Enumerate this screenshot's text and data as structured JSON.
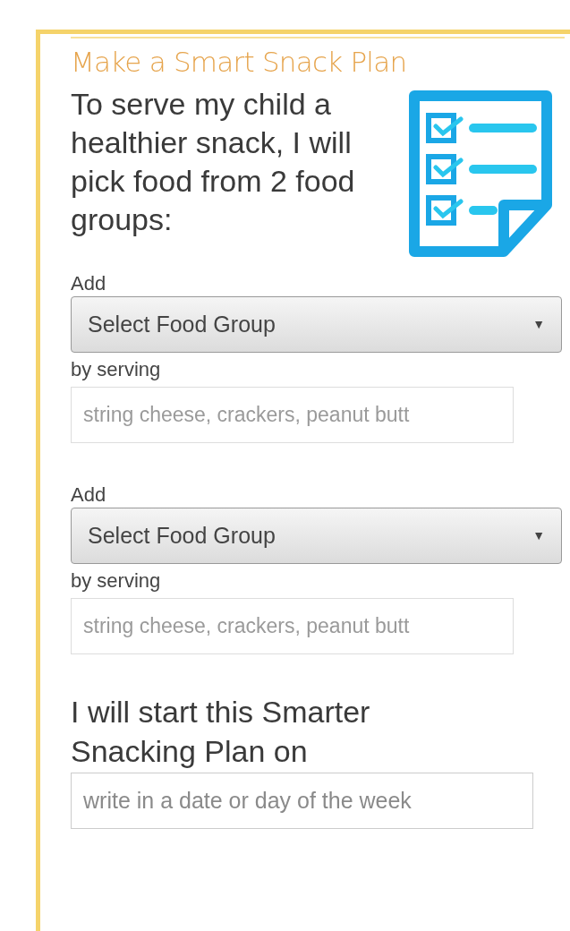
{
  "title": "Make a Smart Snack Plan",
  "intro": "To serve my child a healthier snack, I will pick food from 2 food groups:",
  "groups": [
    {
      "add_label": "Add",
      "select": {
        "value": "Select Food Group",
        "arrow": "▼"
      },
      "serving_label": "by serving",
      "serving_field": {
        "placeholder": "string cheese, crackers, peanut butt"
      }
    },
    {
      "add_label": "Add",
      "select": {
        "value": "Select Food Group",
        "arrow": "▼"
      },
      "serving_label": "by serving",
      "serving_field": {
        "placeholder": "string cheese, crackers, peanut butt"
      }
    }
  ],
  "start": {
    "heading": "I will start this Smarter Snacking Plan on",
    "field": {
      "placeholder": "write in a date or day of the week"
    }
  }
}
